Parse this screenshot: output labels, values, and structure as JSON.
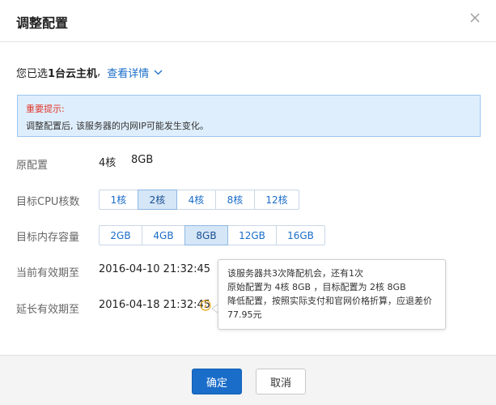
{
  "dialog": {
    "title": "调整配置"
  },
  "selection": {
    "prefix": "您已选",
    "count_text": "1台云主机",
    "suffix": ",",
    "details_link": "查看详情"
  },
  "notice": {
    "title": "重要提示:",
    "text": "调整配置后, 该服务器的内网IP可能发生变化。"
  },
  "original_config": {
    "label": "原配置",
    "cpu": "4核",
    "memory": "8GB"
  },
  "cpu": {
    "label": "目标CPU核数",
    "options": [
      "1核",
      "2核",
      "4核",
      "8核",
      "12核"
    ],
    "selected": "2核"
  },
  "memory": {
    "label": "目标内存容量",
    "options": [
      "2GB",
      "4GB",
      "8GB",
      "12GB",
      "16GB"
    ],
    "selected": "8GB"
  },
  "current_expiry": {
    "label": "当前有效期至",
    "value": "2016-04-10 21:32:45"
  },
  "extended_expiry": {
    "label": "延长有效期至",
    "value": "2016-04-18 21:32:45"
  },
  "tooltip": {
    "line1": "该服务器共3次降配机会，还有1次",
    "line2": "原始配置为 4核 8GB ，目标配置为 2核 8GB",
    "line3": "降低配置，按照实际支付和官网价格折算，应退差价",
    "line4": "77.95元"
  },
  "footer": {
    "confirm": "确定",
    "cancel": "取消"
  },
  "colors": {
    "accent": "#1a6dc9",
    "notice_bg": "#dfeefc",
    "notice_title": "#e0382b",
    "info_icon": "#e8a317"
  }
}
